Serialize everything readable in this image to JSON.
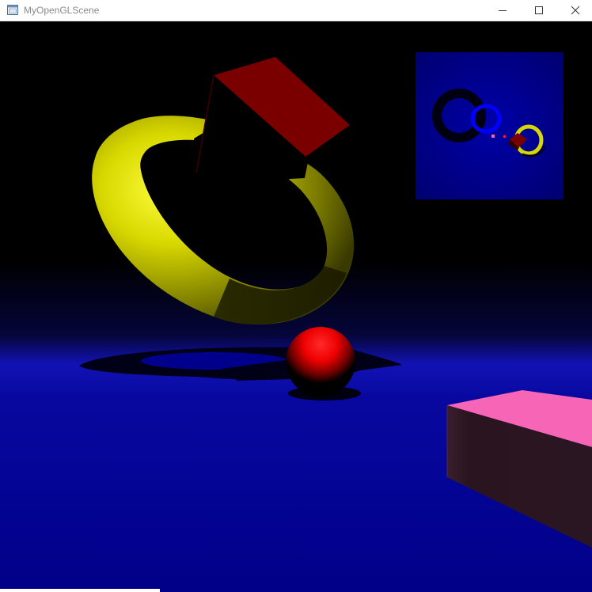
{
  "window": {
    "title": "MyOpenGLScene",
    "app_icon": "window-app-icon",
    "controls": {
      "minimize_icon": "minimize-icon",
      "maximize_icon": "maximize-icon",
      "close_icon": "close-icon"
    }
  },
  "colors": {
    "titlebar_bg": "#ffffff",
    "title_text": "#8a8a8a",
    "floor": "#00008b",
    "horizon_glow": "#1010b8",
    "torus_yellow": "#d8d800",
    "cube_red": "#7a0000",
    "sphere_red": "#ff0000",
    "box_pink_top": "#f766b6",
    "box_side": "#2a1620",
    "minimap_bg": "#000080",
    "minimap_ring_blue": "#0000ff"
  },
  "scene_objects": [
    "yellow-torus",
    "dark-red-cube",
    "red-sphere",
    "pink-box",
    "floor-plane",
    "shadow-map-preview"
  ]
}
